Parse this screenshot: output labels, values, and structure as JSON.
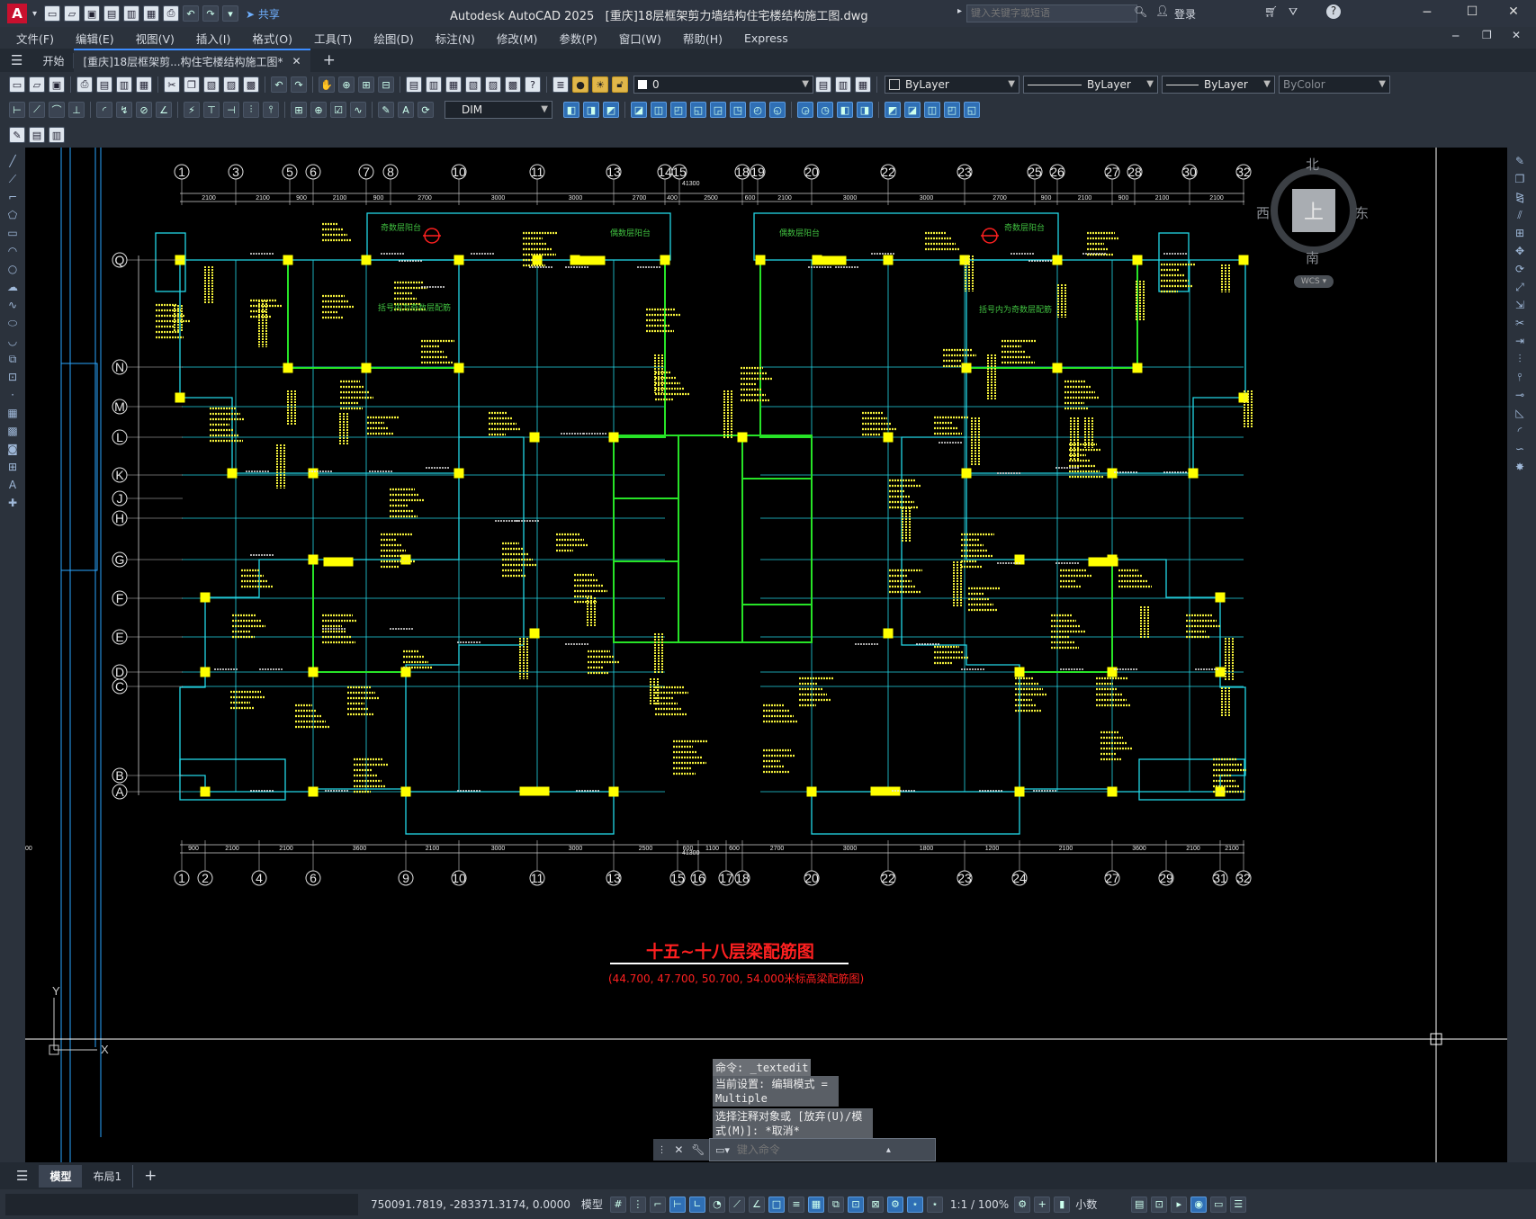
{
  "window": {
    "app_title": "Autodesk AutoCAD 2025",
    "doc_title": "[重庆]18层框架剪力墙结构住宅楼结构施工图.dwg",
    "search_placeholder": "键入关键字或短语",
    "login": "登录",
    "share": "共享"
  },
  "menu": [
    "文件(F)",
    "编辑(E)",
    "视图(V)",
    "插入(I)",
    "格式(O)",
    "工具(T)",
    "绘图(D)",
    "标注(N)",
    "修改(M)",
    "参数(P)",
    "窗口(W)",
    "帮助(H)",
    "Express"
  ],
  "tabs": {
    "start": "开始",
    "doc": "[重庆]18层框架剪...构住宅楼结构施工图*"
  },
  "toolbar": {
    "layer_value": "0",
    "color_value": "ByLayer",
    "linetype_value": "ByLayer",
    "lineweight_value": "ByLayer",
    "plotstyle_value": "ByColor",
    "dimstyle_value": "DIM"
  },
  "viewcube": {
    "north": "北",
    "south": "南",
    "east": "东",
    "west": "西",
    "top": "上",
    "wcs": "WCS"
  },
  "drawing": {
    "title": "十五~十八层梁配筋图",
    "subtitle": "(44.700, 47.700, 50.700, 54.000米标高梁配筋图)",
    "balcony_note": "奇数层阳台",
    "balcony_note2": "偶数层阳台",
    "bracket_note": "括号内为奇数层配筋",
    "top_axes": [
      "1",
      "3",
      "5",
      "6",
      "7",
      "8",
      "10",
      "11",
      "13",
      "14",
      "15",
      "18",
      "19",
      "20",
      "22",
      "23",
      "25",
      "26",
      "27",
      "28",
      "30",
      "32"
    ],
    "bottom_axes": [
      "1",
      "2",
      "4",
      "6",
      "9",
      "10",
      "11",
      "13",
      "15",
      "16",
      "17",
      "18",
      "20",
      "22",
      "23",
      "24",
      "27",
      "29",
      "31",
      "32"
    ],
    "left_axes": [
      "Q",
      "N",
      "M",
      "L",
      "K",
      "J",
      "H",
      "G",
      "F",
      "E",
      "D",
      "C",
      "B",
      "A"
    ],
    "total_dim": "41300",
    "top_dims": [
      "2100",
      "2100",
      "900",
      "2100",
      "900",
      "2700",
      "3000",
      "3000",
      "2700",
      "400",
      "2500",
      "600",
      "2100",
      "3000",
      "3000",
      "2700",
      "900",
      "2100",
      "900",
      "2100",
      "2100"
    ],
    "bottom_dims": [
      "900",
      "2100",
      "2100",
      "3600",
      "2100",
      "3000",
      "3000",
      "2500",
      "600",
      "1100",
      "600",
      "2700",
      "3000",
      "1800",
      "1200",
      "2100",
      "3600",
      "2100",
      "2100",
      "2100"
    ]
  },
  "command": {
    "hist1": "命令: _textedit",
    "hist2": "当前设置: 编辑模式 = Multiple",
    "hist3": "选择注释对象或 [放弃(U)/模式(M)]: *取消*",
    "placeholder": "键入命令"
  },
  "layouts": [
    "模型",
    "布局1"
  ],
  "status": {
    "coords": "750091.7819, -283371.3174, 0.0000",
    "model": "模型",
    "scale": "1:1 / 100%",
    "units": "小数"
  }
}
